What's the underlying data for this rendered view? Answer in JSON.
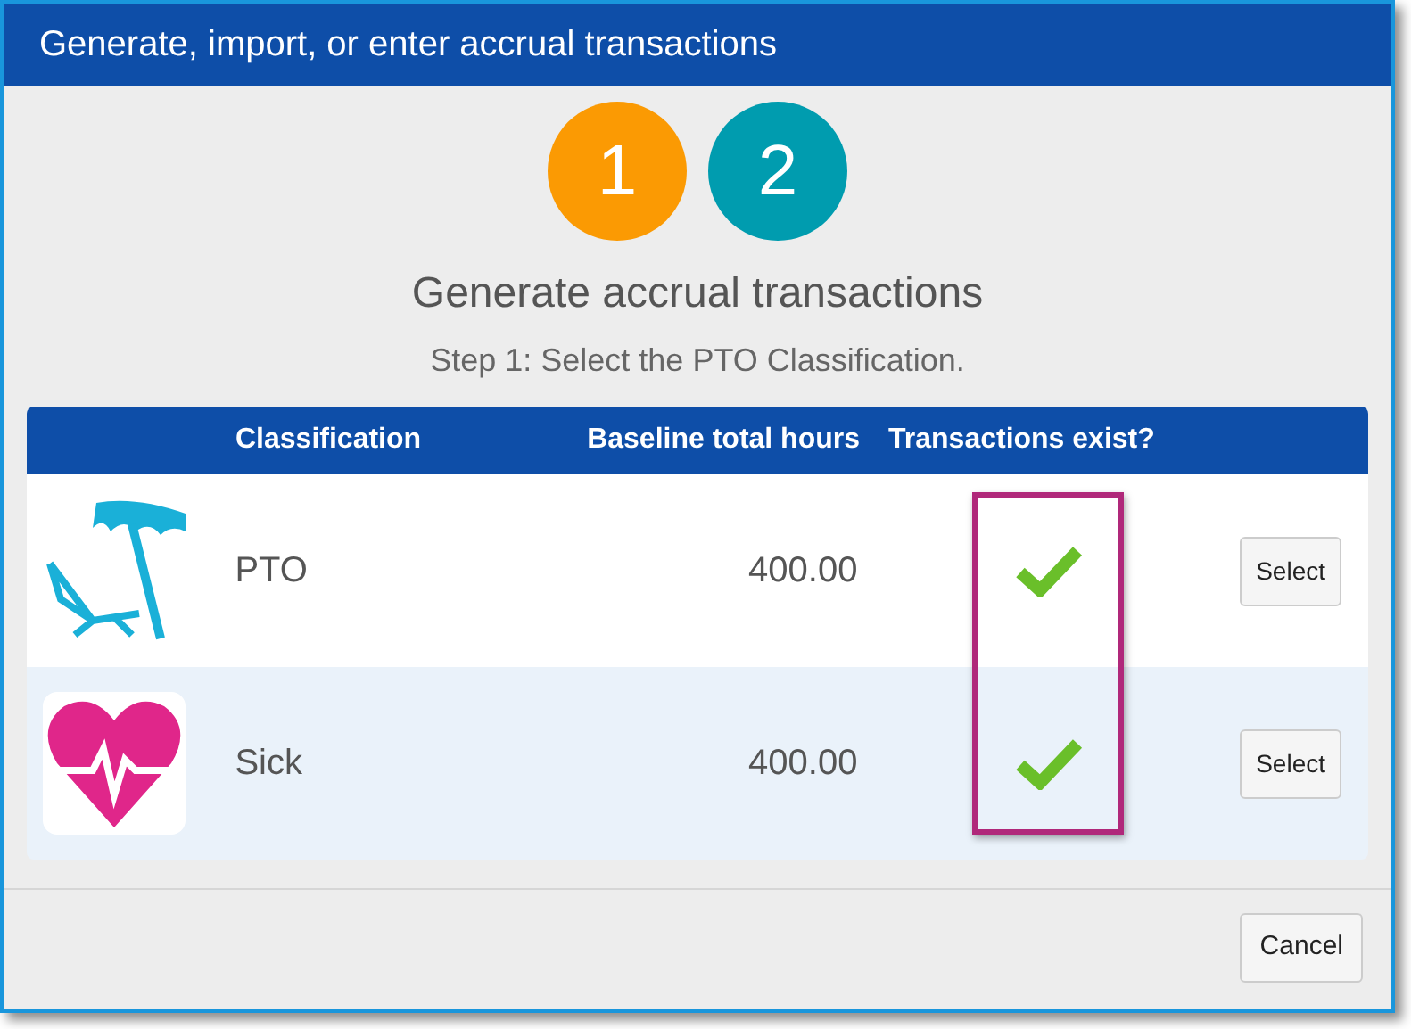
{
  "window": {
    "title": "Generate, import, or enter accrual transactions"
  },
  "steps": [
    {
      "label": "1",
      "selected": true
    },
    {
      "label": "2",
      "selected": false
    }
  ],
  "heading": "Generate accrual transactions",
  "instruction": "Step 1: Select the PTO Classification.",
  "table": {
    "columns": [
      "Classification",
      "Baseline total hours",
      "Transactions exist?"
    ],
    "rows": [
      {
        "kind": "beach",
        "classification": "PTO",
        "hours": "400.00",
        "exists": true,
        "button": "Select"
      },
      {
        "kind": "heart",
        "classification": "Sick",
        "hours": "400.00",
        "exists": true,
        "button": "Select"
      }
    ]
  },
  "buttons": [
    "Cancel"
  ]
}
